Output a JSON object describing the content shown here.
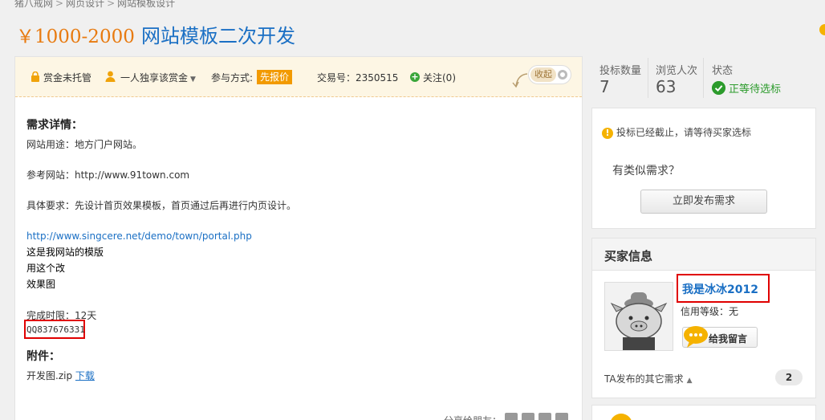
{
  "breadcrumb": [
    "猪八戒网",
    "网页设计",
    "网站模板设计"
  ],
  "header": {
    "price": "￥1000-2000",
    "title": "网站模板二次开发"
  },
  "infobar": {
    "escrow": "赏金未托管",
    "reward_mode": "一人独享该赏金",
    "participation_label": "参与方式:",
    "participation_value": "先报价",
    "trade_no": "交易号：2350515",
    "follow": "关注(0)",
    "collapse": "收起"
  },
  "content": {
    "requirements_heading": "需求详情：",
    "purpose": "网站用途：地方门户网站。",
    "reference": "参考网站：http://www.91town.com",
    "specifics": "具体要求：先设计首页效果模板，首页通过后再进行内页设计。",
    "link": "http://www.singcere.net/demo/town/portal.php",
    "note1": "这是我网站的模版",
    "note2": "用这个改",
    "note3": "效果图",
    "deadline": "完成时限：12天",
    "qq": "QQ837676331",
    "attachments_heading": "附件：",
    "attachment_file": "开发图.zip",
    "download": "下载",
    "share_label": "分享给朋友："
  },
  "stats": {
    "bids_label": "投标数量",
    "bids_value": "7",
    "views_label": "浏览人次",
    "views_value": "63",
    "status_label": "状态",
    "status_value": "正等待选标"
  },
  "bid_closed": {
    "notice": "投标已经截止，请等待买家选标",
    "similar": "有类似需求？",
    "post_button": "立即发布需求"
  },
  "buyer": {
    "heading": "买家信息",
    "name": "我是冰冰2012",
    "credit": "信用等级：无",
    "message_button": "给我留言",
    "other_requests": "TA发布的其它需求",
    "other_count": "2"
  },
  "colors": {
    "accent_orange": "#e87a0f",
    "link_blue": "#1a6fc4",
    "status_green": "#2c9b2c",
    "highlight_red": "#e00000"
  }
}
